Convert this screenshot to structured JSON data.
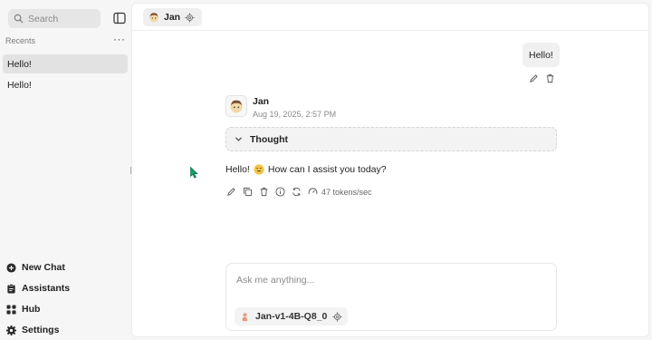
{
  "sidebar": {
    "search_placeholder": "Search",
    "recents_label": "Recents",
    "recents_more": "···",
    "threads": [
      {
        "label": "Hello!",
        "active": true
      },
      {
        "label": "Hello!",
        "active": false
      }
    ],
    "nav": [
      {
        "label": "New Chat",
        "icon": "plus-circle-icon"
      },
      {
        "label": "Assistants",
        "icon": "clipboard-icon"
      },
      {
        "label": "Hub",
        "icon": "grid-icon"
      },
      {
        "label": "Settings",
        "icon": "gear-icon"
      }
    ]
  },
  "header": {
    "assistant_name": "Jan"
  },
  "conversation": {
    "user_message": "Hello!",
    "assistant": {
      "name": "Jan",
      "timestamp": "Aug 19, 2025, 2:57 PM",
      "thought_label": "Thought",
      "answer_before": "Hello!",
      "answer_after": "How can I assist you today?",
      "tokens": "47 tokens/sec"
    }
  },
  "composer": {
    "placeholder": "Ask me anything...",
    "model": "Jan-v1-4B-Q8_0"
  },
  "colors": {
    "accent": "#16a36b",
    "background": "#f6f6f6",
    "surface": "#ffffff"
  }
}
